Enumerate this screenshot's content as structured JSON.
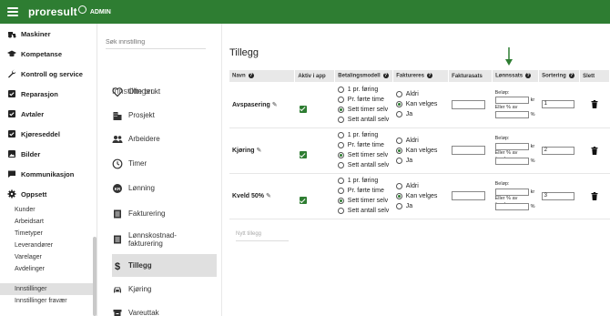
{
  "topbar": {
    "brand": "proresult",
    "admin": "ADMIN"
  },
  "leftnav": {
    "groups": [
      {
        "label": "Maskiner",
        "icon": "tractor-icon"
      },
      {
        "label": "Kompetanse",
        "icon": "graduation-cap-icon"
      },
      {
        "label": "Kontroll og service",
        "icon": "wrench-icon"
      },
      {
        "label": "Reparasjon",
        "icon": "checklist-icon"
      },
      {
        "label": "Avtaler",
        "icon": "checkbox-icon"
      },
      {
        "label": "Kjøreseddel",
        "icon": "checkbox-icon"
      },
      {
        "label": "Bilder",
        "icon": "image-icon"
      },
      {
        "label": "Kommunikasjon",
        "icon": "chat-icon"
      },
      {
        "label": "Oppsett",
        "icon": "gear-icon"
      }
    ],
    "subitems": [
      "Kunder",
      "Arbeidsart",
      "Timetyper",
      "Leverandører",
      "Varelager",
      "Avdelinger"
    ],
    "bottom_items": [
      "Innstillinger",
      "Innstillinger fravær"
    ]
  },
  "settings": {
    "search_placeholder": "Søk innstilling",
    "heading": "Innstillinger",
    "items": [
      {
        "label": "Ofte brukt",
        "icon": "heart-icon"
      },
      {
        "label": "Prosjekt",
        "icon": "building-icon"
      },
      {
        "label": "Arbeidere",
        "icon": "people-icon"
      },
      {
        "label": "Timer",
        "icon": "clock-icon"
      },
      {
        "label": "Lønning",
        "icon": "money-icon"
      },
      {
        "label": "Fakturering",
        "icon": "invoice-icon"
      },
      {
        "label": "Lønnskostnad-fakturering",
        "icon": "invoice-icon"
      },
      {
        "label": "Tillegg",
        "icon": "dollar-icon"
      },
      {
        "label": "Kjøring",
        "icon": "car-icon"
      },
      {
        "label": "Vareuttak",
        "icon": "box-icon"
      }
    ],
    "active_item": "Tillegg"
  },
  "main": {
    "title": "Tillegg",
    "columns": [
      "Navn",
      "Aktiv i app",
      "Betalingsmodell",
      "Faktureres",
      "Fakturasats",
      "Lønnssats",
      "Sortering",
      "Slett"
    ],
    "betalingsmodell_options": [
      "1 pr. føring",
      "Pr. førte time",
      "Sett timer selv",
      "Sett antall selv"
    ],
    "faktureres_options": [
      "Aldri",
      "Kan velges",
      "Ja"
    ],
    "lonn_labels": {
      "belop": "Beløp:",
      "kr": "kr",
      "eller": "Eller % av timelønn",
      "pct": "%"
    },
    "rows": [
      {
        "name": "Avspasering",
        "active": true,
        "betaling": "Sett timer selv",
        "faktureres": "Kan velges",
        "fakturasats": "",
        "belop": "",
        "prosent": "",
        "sortering": "1"
      },
      {
        "name": "Kjøring",
        "active": true,
        "betaling": "Sett timer selv",
        "faktureres": "Kan velges",
        "fakturasats": "",
        "belop": "",
        "prosent": "",
        "sortering": "2"
      },
      {
        "name": "Kveld 50%",
        "active": true,
        "betaling": "Sett timer selv",
        "faktureres": "Kan velges",
        "fakturasats": "",
        "belop": "",
        "prosent": "",
        "sortering": "3"
      }
    ],
    "new_row_placeholder": "Nytt tillegg",
    "accent_color": "#2e7d32"
  }
}
